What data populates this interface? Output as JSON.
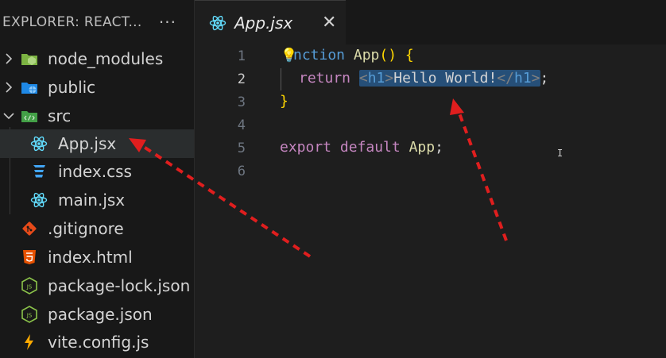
{
  "sidebar": {
    "title": "EXPLORER: REACT...",
    "more": "···",
    "items": [
      {
        "label": "node_modules",
        "type": "folder",
        "icon": "node-folder-icon",
        "color": "#8bc34a"
      },
      {
        "label": "public",
        "type": "folder",
        "icon": "globe-folder-icon",
        "color": "#42a5f5"
      },
      {
        "label": "src",
        "type": "folder-open",
        "icon": "src-folder-icon",
        "color": "#4caf50"
      },
      {
        "label": "App.jsx",
        "type": "file",
        "icon": "react-icon",
        "color": "#61dafb"
      },
      {
        "label": "index.css",
        "type": "file",
        "icon": "css-icon",
        "color": "#42a5f5"
      },
      {
        "label": "main.jsx",
        "type": "file",
        "icon": "react-icon",
        "color": "#61dafb"
      },
      {
        "label": ".gitignore",
        "type": "file",
        "icon": "git-icon",
        "color": "#e64a19"
      },
      {
        "label": "index.html",
        "type": "file",
        "icon": "html-icon",
        "color": "#e65100"
      },
      {
        "label": "package-lock.json",
        "type": "file",
        "icon": "nodejs-icon",
        "color": "#8bc34a"
      },
      {
        "label": "package.json",
        "type": "file",
        "icon": "nodejs-icon",
        "color": "#8bc34a"
      },
      {
        "label": "vite.config.js",
        "type": "file",
        "icon": "lightning-icon",
        "color": "#ffab00"
      }
    ]
  },
  "tab": {
    "label": "App.jsx",
    "close": "✕",
    "icon": "react-icon"
  },
  "editor": {
    "line_numbers": [
      "1",
      "2",
      "3",
      "4",
      "5",
      "6"
    ],
    "active_line": "2",
    "lines": {
      "l1": {
        "kw": "nction",
        "fn": "App",
        "paren": "()",
        "brace": "{"
      },
      "l2": {
        "kw": "return",
        "open_lt": "<",
        "open_tag": "h1",
        "open_gt": ">",
        "text": "Hello World!",
        "close_lt": "</",
        "close_tag": "h1",
        "close_gt": ">",
        "semi": ";"
      },
      "l3": {
        "brace": "}"
      },
      "l5": {
        "kw1": "export",
        "kw2": "default",
        "name": "App",
        "semi": ";"
      }
    },
    "ibeam": "I"
  },
  "colors": {
    "accent": "#264f78",
    "annotation_arrow": "#e01e1e"
  }
}
